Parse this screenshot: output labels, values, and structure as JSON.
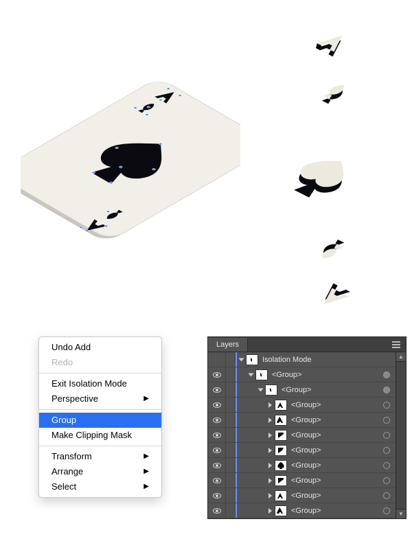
{
  "context_menu": {
    "items": [
      {
        "label": "Undo Add",
        "disabled": false,
        "submenu": false,
        "selected": false
      },
      {
        "label": "Redo",
        "disabled": true,
        "submenu": false,
        "selected": false
      },
      {
        "sep": true
      },
      {
        "label": "Exit Isolation Mode",
        "disabled": false,
        "submenu": false,
        "selected": false
      },
      {
        "label": "Perspective",
        "disabled": false,
        "submenu": true,
        "selected": false
      },
      {
        "sep": true
      },
      {
        "label": "Group",
        "disabled": false,
        "submenu": false,
        "selected": true
      },
      {
        "label": "Make Clipping Mask",
        "disabled": false,
        "submenu": false,
        "selected": false
      },
      {
        "sep": true
      },
      {
        "label": "Transform",
        "disabled": false,
        "submenu": true,
        "selected": false
      },
      {
        "label": "Arrange",
        "disabled": false,
        "submenu": true,
        "selected": false
      },
      {
        "label": "Select",
        "disabled": false,
        "submenu": true,
        "selected": false
      }
    ]
  },
  "layers_panel": {
    "title": "Layers",
    "rows": [
      {
        "indent": 0,
        "open": true,
        "label": "Isolation Mode",
        "eye": false,
        "target": "none",
        "thumb": "iso"
      },
      {
        "indent": 1,
        "open": true,
        "label": "<Group>",
        "eye": true,
        "target": "filled",
        "thumb": "iso"
      },
      {
        "indent": 2,
        "open": true,
        "label": "<Group>",
        "eye": true,
        "target": "filled",
        "thumb": "iso"
      },
      {
        "indent": 3,
        "open": false,
        "label": "<Group>",
        "eye": true,
        "target": "ring",
        "thumb": "a1"
      },
      {
        "indent": 3,
        "open": false,
        "label": "<Group>",
        "eye": true,
        "target": "ring",
        "thumb": "a2"
      },
      {
        "indent": 3,
        "open": false,
        "label": "<Group>",
        "eye": true,
        "target": "ring",
        "thumb": "s1"
      },
      {
        "indent": 3,
        "open": false,
        "label": "<Group>",
        "eye": true,
        "target": "ring",
        "thumb": "s2"
      },
      {
        "indent": 3,
        "open": false,
        "label": "<Group>",
        "eye": true,
        "target": "ring",
        "thumb": "spade"
      },
      {
        "indent": 3,
        "open": false,
        "label": "<Group>",
        "eye": true,
        "target": "ring",
        "thumb": "s1"
      },
      {
        "indent": 3,
        "open": false,
        "label": "<Group>",
        "eye": true,
        "target": "ring",
        "thumb": "a1"
      },
      {
        "indent": 3,
        "open": false,
        "label": "<Group>",
        "eye": true,
        "target": "ring",
        "thumb": "a2"
      }
    ]
  }
}
